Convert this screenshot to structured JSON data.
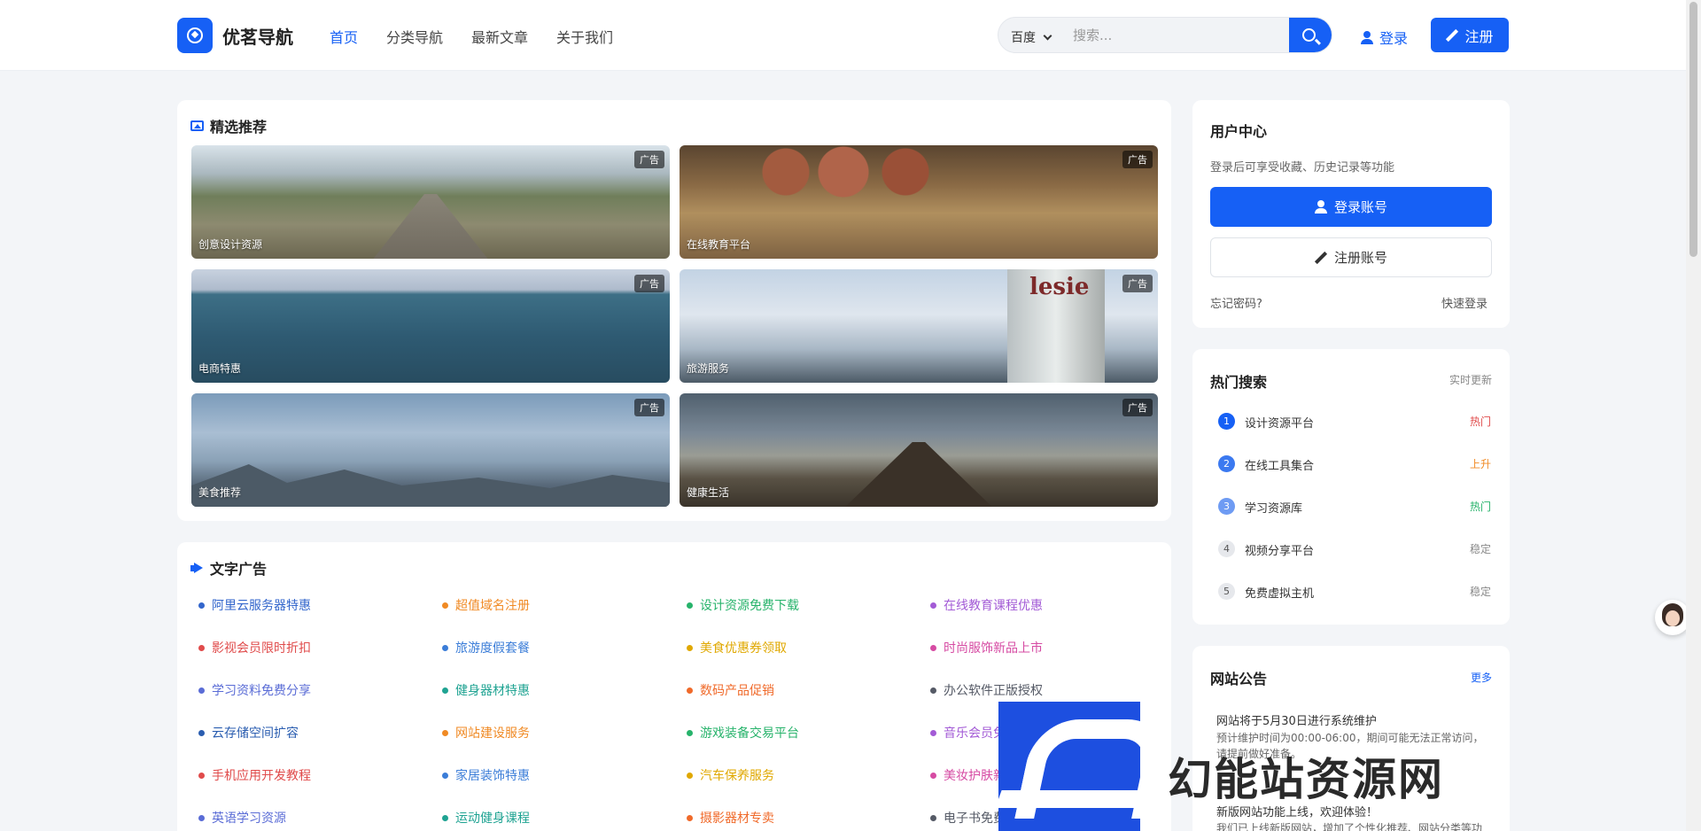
{
  "header": {
    "site_name": "优茗导航",
    "nav": [
      "首页",
      "分类导航",
      "最新文章",
      "关于我们"
    ],
    "search_engine": "百度",
    "search_placeholder": "搜索...",
    "login": "登录",
    "register": "注册",
    "brand_color": "#1660f5"
  },
  "featured": {
    "title": "精选推荐",
    "ad_badge": "广告",
    "tiles": [
      "创意设计资源",
      "在线教育平台",
      "电商特惠",
      "旅游服务",
      "美食推荐",
      "健康生活"
    ]
  },
  "text_ads": {
    "title": "文字广告",
    "items": [
      {
        "label": "阿里云服务器特惠",
        "color": "#3366cc"
      },
      {
        "label": "超值域名注册",
        "color": "#f08a24"
      },
      {
        "label": "设计资源免费下载",
        "color": "#27b36b"
      },
      {
        "label": "在线教育课程优惠",
        "color": "#a35bd6"
      },
      {
        "label": "影视会员限时折扣",
        "color": "#e04b4b"
      },
      {
        "label": "旅游度假套餐",
        "color": "#3b7dd8"
      },
      {
        "label": "美食优惠券领取",
        "color": "#e0a800"
      },
      {
        "label": "时尚服饰新品上市",
        "color": "#d64ba3"
      },
      {
        "label": "学习资料免费分享",
        "color": "#5a6cd6"
      },
      {
        "label": "健身器材特惠",
        "color": "#1fa392"
      },
      {
        "label": "数码产品促销",
        "color": "#f06a2a"
      },
      {
        "label": "办公软件正版授权",
        "color": "#555a66"
      },
      {
        "label": "云存储空间扩容",
        "color": "#2a5db0"
      },
      {
        "label": "网站建设服务",
        "color": "#f08a24"
      },
      {
        "label": "游戏装备交易平台",
        "color": "#27b36b"
      },
      {
        "label": "音乐会员免费领取",
        "color": "#a35bd6"
      },
      {
        "label": "手机应用开发教程",
        "color": "#e04b4b"
      },
      {
        "label": "家居装饰特惠",
        "color": "#3b7dd8"
      },
      {
        "label": "汽车保养服务",
        "color": "#e0a800"
      },
      {
        "label": "美妆护肤新品",
        "color": "#d64ba3"
      },
      {
        "label": "英语学习资源",
        "color": "#5a6cd6"
      },
      {
        "label": "运动健身课程",
        "color": "#1fa392"
      },
      {
        "label": "摄影器材专卖",
        "color": "#f06a2a"
      },
      {
        "label": "电子书免费",
        "color": "#555a66"
      }
    ]
  },
  "user_center": {
    "title": "用户中心",
    "desc": "登录后可享受收藏、历史记录等功能",
    "login_btn": "登录账号",
    "register_btn": "注册账号",
    "forgot": "忘记密码?",
    "quick_login": "快速登录"
  },
  "hot_search": {
    "title": "热门搜索",
    "subtitle": "实时更新",
    "items": [
      {
        "rank": "1",
        "name": "设计资源平台",
        "tag": "热门",
        "tag_color": "#e04b4b",
        "rank_bg": "#1660f5"
      },
      {
        "rank": "2",
        "name": "在线工具集合",
        "tag": "上升",
        "tag_color": "#f08a24",
        "rank_bg": "#3b79f0"
      },
      {
        "rank": "3",
        "name": "学习资源库",
        "tag": "热门",
        "tag_color": "#27b36b",
        "rank_bg": "#6e9bf3"
      },
      {
        "rank": "4",
        "name": "视频分享平台",
        "tag": "稳定",
        "tag_color": "#888888",
        "rank_bg": "#e6e8ec"
      },
      {
        "rank": "5",
        "name": "免费虚拟主机",
        "tag": "稳定",
        "tag_color": "#888888",
        "rank_bg": "#e6e8ec"
      }
    ]
  },
  "notice": {
    "title": "网站公告",
    "more": "更多",
    "items": [
      {
        "title": "网站将于5月30日进行系统维护",
        "desc": "预计维护时间为00:00-06:00，期间可能无法正常访问，请提前做好准备。"
      },
      {
        "title": "新版网站功能上线，欢迎体验！",
        "desc": "我们已上线新版网站，增加了个性化推荐、网站分类等功"
      }
    ]
  },
  "watermark": {
    "text": "幻能站资源网"
  }
}
